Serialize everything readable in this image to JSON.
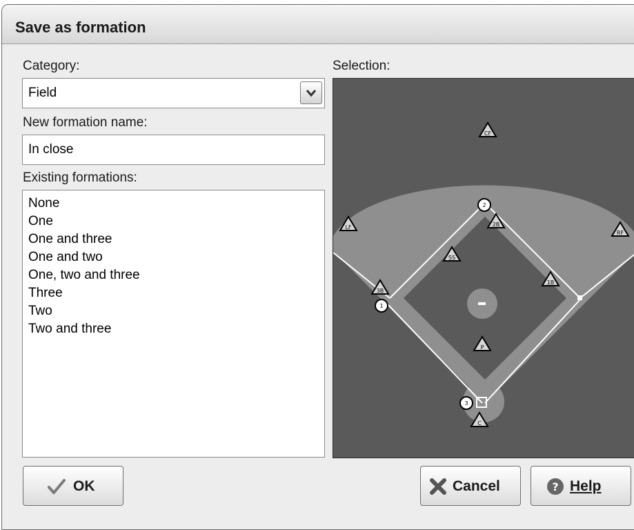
{
  "window": {
    "title": "Save as formation"
  },
  "category": {
    "label": "Category:",
    "value": "Field"
  },
  "formation_name": {
    "label": "New formation name:",
    "value": "In close"
  },
  "existing": {
    "label": "Existing formations:",
    "items": [
      "None",
      "One",
      "One and three",
      "One and two",
      "One, two and three",
      "Three",
      "Two",
      "Two and three"
    ]
  },
  "selection": {
    "label": "Selection:",
    "fielders": [
      {
        "code": "CF"
      },
      {
        "code": "LF"
      },
      {
        "code": "RF"
      },
      {
        "code": "2B"
      },
      {
        "code": "SS"
      },
      {
        "code": "1B"
      },
      {
        "code": "3B"
      },
      {
        "code": "P"
      },
      {
        "code": "C"
      }
    ],
    "runners": [
      {
        "code": "1"
      },
      {
        "code": "2"
      },
      {
        "code": "3"
      }
    ]
  },
  "buttons": {
    "ok": "OK",
    "cancel": "Cancel",
    "help": "Help"
  },
  "colors": {
    "field_bg": "#5a5a5a",
    "outfield": "#8f8f8f",
    "dialog_bg": "#ededed"
  }
}
